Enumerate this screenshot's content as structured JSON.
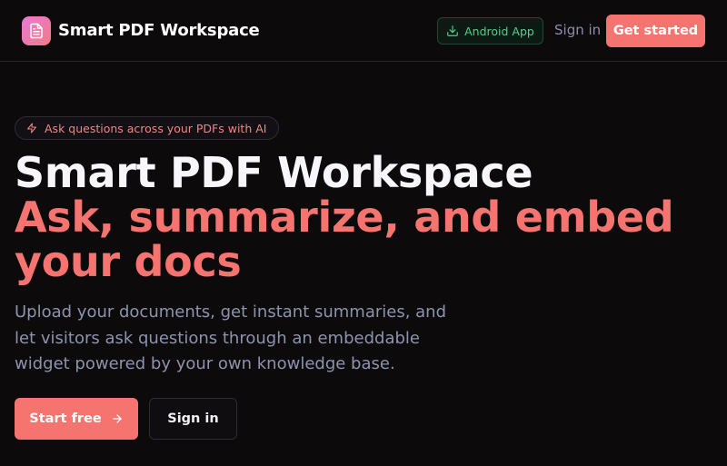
{
  "header": {
    "brand": "Smart PDF Workspace",
    "logo_icon": "document-icon",
    "android_app_label": "Android App",
    "android_icon": "download-icon",
    "sign_in_label": "Sign in",
    "get_started_label": "Get started"
  },
  "hero": {
    "badge_icon": "sparkle-icon",
    "badge_text": "Ask questions across your PDFs with AI",
    "title_line1": "Smart PDF Workspace",
    "title_line2": "Ask, summarize, and embed your docs",
    "description": "Upload your documents, get instant summaries, and let visitors ask questions through an embeddable widget powered by your own knowledge base.",
    "primary_cta_label": "Start free",
    "primary_cta_icon": "arrow-right-icon",
    "secondary_cta_label": "Sign in"
  },
  "colors": {
    "background": "#0c0a0b",
    "accent": "#f57470",
    "android_green": "#4fd08a",
    "muted_text": "#8d93ad"
  }
}
